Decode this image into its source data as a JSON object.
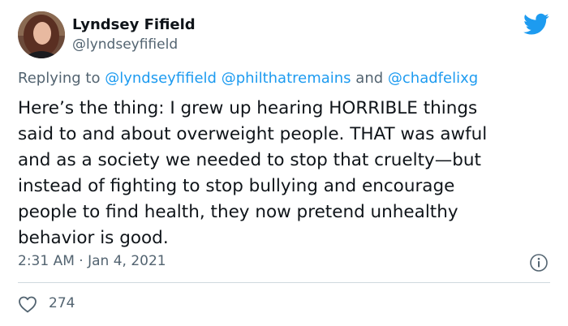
{
  "author": {
    "name": "Lyndsey Fifield",
    "handle": "@lyndseyfifield"
  },
  "reply": {
    "prefix": "Replying to",
    "mention1": "@lyndseyfifield",
    "mention2": "@philthatremains",
    "conjunction": "and",
    "mention3": "@chadfelixg"
  },
  "tweet": {
    "lines": [
      "Here’s the thing: I grew up hearing HORRIBLE things",
      "said to and about overweight people. THAT was awful",
      "and as a society we needed to stop that cruelty—but",
      "instead of fighting to stop bullying and encourage",
      "people to find health, they now pretend unhealthy",
      "behavior is good."
    ],
    "timestamp": "2:31 AM · Jan 4, 2021",
    "likes": "274"
  },
  "icons": {
    "brand": "twitter-bird-icon",
    "info": "info-icon",
    "like": "heart-icon"
  },
  "colors": {
    "accent": "#1d9bf0",
    "secondary_text": "#536471",
    "primary_text": "#0f1419",
    "divider": "#cfd9de"
  }
}
